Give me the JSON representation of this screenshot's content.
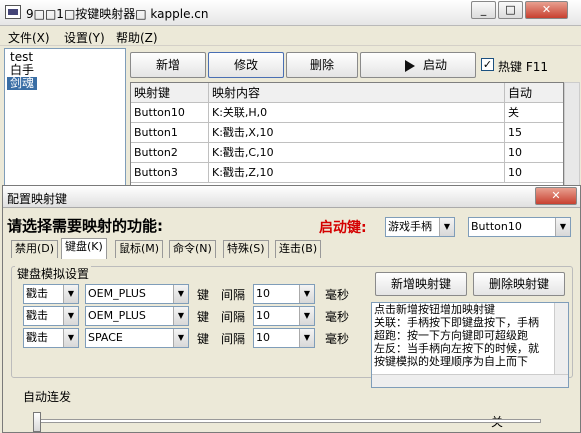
{
  "window": {
    "title": "9□□1□按键映射器□ kapple.cn",
    "controls": [
      "_",
      "□",
      "✕"
    ]
  },
  "menu": [
    "文件(X)",
    "设置(Y)",
    "帮助(Z)"
  ],
  "profiles": [
    "test",
    "白手",
    "剑魂"
  ],
  "toolbar": {
    "add": "新增",
    "edit": "修改",
    "delete": "删除",
    "start": "启动",
    "hotkey": "热键 F11"
  },
  "table": {
    "headers": [
      "映射键",
      "映射内容",
      "自动"
    ],
    "rows": [
      [
        "Button10",
        "K:关联,H,0",
        "关"
      ],
      [
        "Button1",
        "K:戳击,X,10",
        "15"
      ],
      [
        "Button2",
        "K:戳击,C,10",
        "10"
      ],
      [
        "Button3",
        "K:戳击,Z,10",
        "10"
      ]
    ]
  },
  "dialog": {
    "title": "配置映射键",
    "close": "✕",
    "prompt": "请选择需要映射的功能:",
    "start_key_label": "启动键:",
    "device": "游戏手柄",
    "button": "Button10",
    "tabs": [
      "禁用(D)",
      "键盘(K)",
      "鼠标(M)",
      "命令(N)",
      "特殊(S)",
      "连击(B)"
    ],
    "group_label": "键盘模拟设置",
    "key_word": "键",
    "interval_word": "间隔",
    "ms_word": "毫秒",
    "rows": [
      {
        "action": "戳击",
        "key": "OEM_PLUS",
        "interval": "10"
      },
      {
        "action": "戳击",
        "key": "OEM_PLUS",
        "interval": "10"
      },
      {
        "action": "戳击",
        "key": "SPACE",
        "interval": "10"
      }
    ],
    "add_key": "新增映射键",
    "del_key": "删除映射键",
    "notes": [
      "点击新增按钮增加映射键",
      "关联：手柄按下即键盘按下，手柄",
      "超跑：按一下方向键即可超级跑",
      "左反：当手柄向左按下的时候，就",
      "按键模拟的处理顺序为自上而下"
    ],
    "auto_fire": "自动连发",
    "auto_value": "关"
  }
}
